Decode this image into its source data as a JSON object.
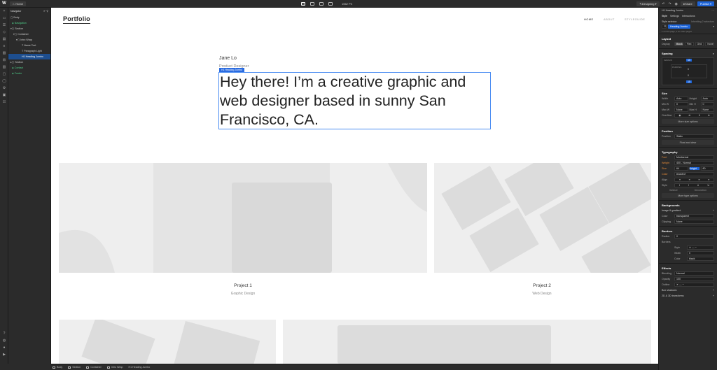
{
  "topbar": {
    "logo": "W",
    "home": "Home",
    "viewport_width": "1562 PX",
    "mode": "Designing",
    "share": "Share",
    "publish": "Publish"
  },
  "navigator": {
    "title": "Navigator",
    "items": [
      {
        "label": "Body"
      },
      {
        "label": "Navigation"
      },
      {
        "label": "Section"
      },
      {
        "label": "Container"
      },
      {
        "label": "Intro Wrap"
      },
      {
        "label": "Name Text"
      },
      {
        "label": "Paragraph Light"
      },
      {
        "label": "Heading Jumbo"
      },
      {
        "label": "Section"
      },
      {
        "label": "Contact"
      },
      {
        "label": "Footer"
      }
    ]
  },
  "site": {
    "brand": "Portfolio",
    "menu": [
      "HOME",
      "ABOUT",
      "STYLEGUIDE"
    ],
    "name": "Jane Lo",
    "role": "Product Designer",
    "selected_tag": "H1 Heading Jumbo",
    "hero": "Hey there! I’m a creative graphic and web designer based in sunny San Francisco, CA.",
    "projects": [
      {
        "title": "Project 1",
        "sub": "Graphic Design"
      },
      {
        "title": "Project 2",
        "sub": "Web Design"
      }
    ]
  },
  "panel": {
    "element": "H1 Heading Jumbo",
    "tabs": [
      "Style",
      "Settings",
      "Interactions"
    ],
    "selector_label": "Style selector",
    "selector_inherit": "Inheriting 2 selectors",
    "selector_value": "Heading Jumbo",
    "selector_note": "1 on this page, 1 on other pages",
    "layout": {
      "title": "Layout",
      "display_label": "Display",
      "display_options": [
        "Block",
        "Flex",
        "Grid",
        "None"
      ]
    },
    "spacing": {
      "title": "Spacing",
      "margin_top": "10",
      "margin_bottom": "15",
      "padding_top": "0",
      "padding_bottom": "0",
      "margin_label": "MARGIN",
      "padding_label": "PADDING"
    },
    "size": {
      "title": "Size",
      "rows": [
        {
          "a": "Width",
          "av": "Auto",
          "b": "Height",
          "bv": "Auto"
        },
        {
          "a": "Min W",
          "av": "0",
          "b": "Min H",
          "bv": "0"
        },
        {
          "a": "Max W",
          "av": "None",
          "b": "Max H",
          "bv": "None"
        }
      ],
      "overflow_label": "Overflow",
      "more": "More size options"
    },
    "position": {
      "title": "Position",
      "label": "Position",
      "value": "Static",
      "float": "Float and clear"
    },
    "typography": {
      "title": "Typography",
      "font_label": "Font",
      "font": "Montserrat",
      "weight_label": "Weight",
      "weight": "400 - Normal",
      "size_label": "Size",
      "size": "64",
      "height_label": "Height",
      "height": "80",
      "color_label": "Color",
      "color": "#1a1b1f",
      "align_label": "Align",
      "style_label": "Style",
      "italicize": "Italicize",
      "decoration": "Decoration",
      "more": "More type options"
    },
    "backgrounds": {
      "title": "Backgrounds",
      "image_label": "Image & gradient",
      "color_label": "Color",
      "color": "transparent",
      "clipping_label": "Clipping",
      "clipping": "None"
    },
    "borders": {
      "title": "Borders",
      "radius_label": "Radius",
      "radius": "0",
      "borders_label": "Borders",
      "style_label": "Style",
      "width_label": "Width",
      "width": "0",
      "color_label": "Color",
      "color": "black"
    },
    "effects": {
      "title": "Effects",
      "blending_label": "Blending",
      "blending": "Normal",
      "opacity_label": "Opacity",
      "opacity": "100",
      "outline_label": "Outline",
      "shadows": "Box shadows",
      "transforms": "2D & 3D transforms"
    }
  },
  "statusbar": {
    "crumbs": [
      "Body",
      "Section",
      "Container",
      "Intro Wrap",
      "H1 Heading Jumbo"
    ]
  }
}
